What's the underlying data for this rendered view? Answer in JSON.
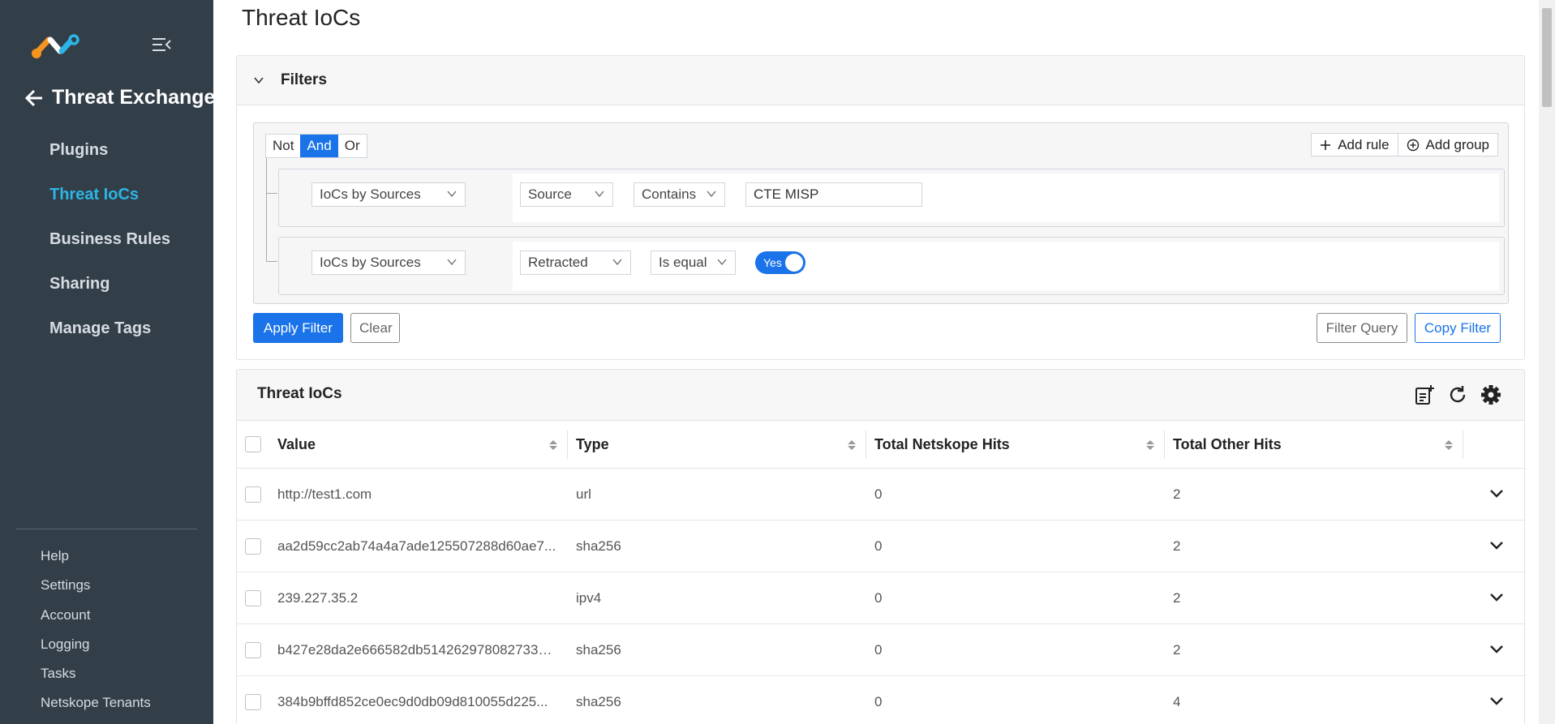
{
  "sidebar": {
    "module_title": "Threat Exchange",
    "nav": [
      {
        "label": "Plugins"
      },
      {
        "label": "Threat IoCs"
      },
      {
        "label": "Business Rules"
      },
      {
        "label": "Sharing"
      },
      {
        "label": "Manage Tags"
      }
    ],
    "bottom": [
      {
        "label": "Help"
      },
      {
        "label": "Settings"
      },
      {
        "label": "Account"
      },
      {
        "label": "Logging"
      },
      {
        "label": "Tasks"
      },
      {
        "label": "Netskope Tenants"
      }
    ],
    "active_color": "#2cb6e6"
  },
  "page": {
    "title": "Threat IoCs"
  },
  "filters": {
    "header": "Filters",
    "combinators": [
      "Not",
      "And",
      "Or"
    ],
    "active_combinator": "And",
    "add_rule": "Add rule",
    "add_group": "Add group",
    "rules": [
      {
        "category": "IoCs by Sources",
        "field": "Source",
        "operator": "Contains",
        "value": "CTE MISP"
      },
      {
        "category": "IoCs by Sources",
        "field": "Retracted",
        "operator": "Is equal",
        "value": "Yes"
      }
    ],
    "apply": "Apply Filter",
    "clear": "Clear",
    "filter_query": "Filter Query",
    "copy_filter": "Copy Filter"
  },
  "table": {
    "title": "Threat IoCs",
    "columns": [
      "Value",
      "Type",
      "Total Netskope Hits",
      "Total Other Hits"
    ],
    "rows": [
      {
        "value": "http://test1.com",
        "type": "url",
        "netskope_hits": "0",
        "other_hits": "2"
      },
      {
        "value": "aa2d59cc2ab74a4a7ade125507288d60ae7...",
        "type": "sha256",
        "netskope_hits": "0",
        "other_hits": "2"
      },
      {
        "value": "239.227.35.2",
        "type": "ipv4",
        "netskope_hits": "0",
        "other_hits": "2"
      },
      {
        "value": "b427e28da2e666582db5142629780827330...",
        "type": "sha256",
        "netskope_hits": "0",
        "other_hits": "2"
      },
      {
        "value": "384b9bffd852ce0ec9d0db09d810055d225...",
        "type": "sha256",
        "netskope_hits": "0",
        "other_hits": "4"
      }
    ]
  },
  "colors": {
    "sidebar_bg": "#323e48",
    "primary": "#1a73e8"
  }
}
